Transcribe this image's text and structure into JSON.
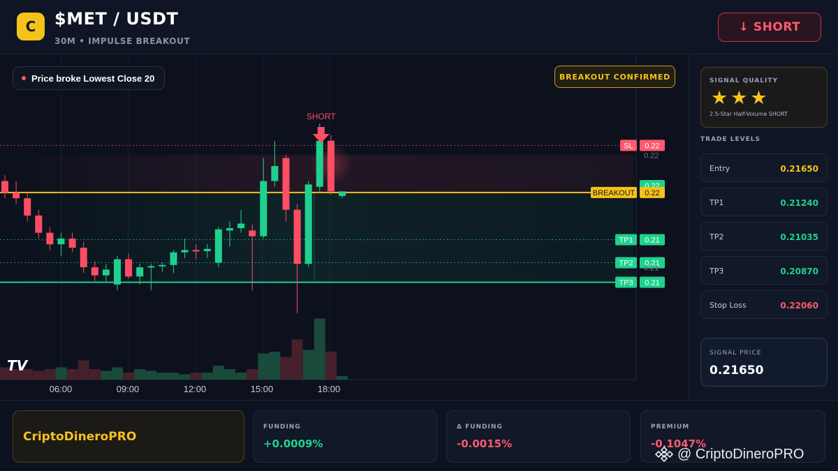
{
  "header": {
    "logo_letter": "C",
    "pair": "$MET / USDT",
    "subtitle": "30M • IMPULSE BREAKOUT",
    "short_button": "↓ SHORT"
  },
  "chart_overlay": {
    "note": "Price broke Lowest Close 20",
    "badge": "BREAKOUT CONFIRMED",
    "signal_label": "SHORT",
    "tv_logo": "TV"
  },
  "chart_data": {
    "type": "candlestick",
    "x_ticks": [
      "06:00",
      "09:00",
      "12:00",
      "15:00",
      "18:00"
    ],
    "candles": [
      {
        "o": 0.2175,
        "h": 0.218,
        "l": 0.216,
        "c": 0.2165
      },
      {
        "o": 0.2165,
        "h": 0.2175,
        "l": 0.2155,
        "c": 0.216
      },
      {
        "o": 0.216,
        "h": 0.2165,
        "l": 0.214,
        "c": 0.2145
      },
      {
        "o": 0.2145,
        "h": 0.215,
        "l": 0.2125,
        "c": 0.213
      },
      {
        "o": 0.213,
        "h": 0.2135,
        "l": 0.2115,
        "c": 0.212
      },
      {
        "o": 0.212,
        "h": 0.213,
        "l": 0.211,
        "c": 0.2125
      },
      {
        "o": 0.2125,
        "h": 0.213,
        "l": 0.2113,
        "c": 0.2117
      },
      {
        "o": 0.2117,
        "h": 0.2122,
        "l": 0.2095,
        "c": 0.21
      },
      {
        "o": 0.21,
        "h": 0.2105,
        "l": 0.2088,
        "c": 0.2093
      },
      {
        "o": 0.2093,
        "h": 0.2103,
        "l": 0.2088,
        "c": 0.2098
      },
      {
        "o": 0.2085,
        "h": 0.211,
        "l": 0.208,
        "c": 0.2107
      },
      {
        "o": 0.2107,
        "h": 0.2112,
        "l": 0.209,
        "c": 0.2092
      },
      {
        "o": 0.2092,
        "h": 0.2103,
        "l": 0.2085,
        "c": 0.21
      },
      {
        "o": 0.21,
        "h": 0.2103,
        "l": 0.208,
        "c": 0.2101
      },
      {
        "o": 0.2101,
        "h": 0.2104,
        "l": 0.2096,
        "c": 0.2102
      },
      {
        "o": 0.2102,
        "h": 0.2115,
        "l": 0.2095,
        "c": 0.2113
      },
      {
        "o": 0.2113,
        "h": 0.2125,
        "l": 0.2108,
        "c": 0.2115
      },
      {
        "o": 0.2115,
        "h": 0.212,
        "l": 0.2107,
        "c": 0.2114
      },
      {
        "o": 0.2114,
        "h": 0.212,
        "l": 0.2108,
        "c": 0.2116
      },
      {
        "o": 0.2104,
        "h": 0.2135,
        "l": 0.21,
        "c": 0.2133
      },
      {
        "o": 0.2132,
        "h": 0.214,
        "l": 0.2118,
        "c": 0.2134
      },
      {
        "o": 0.2134,
        "h": 0.215,
        "l": 0.213,
        "c": 0.2138
      },
      {
        "o": 0.2132,
        "h": 0.2137,
        "l": 0.208,
        "c": 0.2127
      },
      {
        "o": 0.2127,
        "h": 0.2195,
        "l": 0.2125,
        "c": 0.2175
      },
      {
        "o": 0.2175,
        "h": 0.221,
        "l": 0.217,
        "c": 0.2188
      },
      {
        "o": 0.2195,
        "h": 0.2198,
        "l": 0.214,
        "c": 0.215
      },
      {
        "o": 0.215,
        "h": 0.2155,
        "l": 0.206,
        "c": 0.2103
      },
      {
        "o": 0.2103,
        "h": 0.2175,
        "l": 0.21,
        "c": 0.2172
      },
      {
        "o": 0.217,
        "h": 0.2225,
        "l": 0.2165,
        "c": 0.221
      },
      {
        "o": 0.221,
        "h": 0.2215,
        "l": 0.2163,
        "c": 0.2166
      },
      {
        "o": 0.2162,
        "h": 0.2166,
        "l": 0.216,
        "c": 0.2166
      }
    ],
    "volume_relative": [
      0.35,
      0.3,
      0.3,
      0.25,
      0.3,
      0.35,
      0.3,
      0.55,
      0.3,
      0.25,
      0.35,
      0.2,
      0.3,
      0.25,
      0.2,
      0.2,
      0.15,
      0.2,
      0.2,
      0.4,
      0.3,
      0.2,
      0.3,
      0.75,
      0.8,
      0.65,
      1.15,
      0.85,
      1.75,
      0.8,
      0.1
    ],
    "levels": [
      {
        "name": "SL",
        "label": "0.22",
        "price": 0.2206,
        "color": "#ff5a6e"
      },
      {
        "name": "",
        "label": "0.22",
        "price": 0.2171,
        "color": "#1fd18e"
      },
      {
        "name": "BREAKOUT",
        "label": "0.22",
        "price": 0.2165,
        "color": "#f4c21a"
      },
      {
        "name": "TP1",
        "label": "0.21",
        "price": 0.2124,
        "color": "#1fd18e"
      },
      {
        "name": "TP2",
        "label": "0.21",
        "price": 0.2104,
        "color": "#1fd18e"
      },
      {
        "name": "TP3",
        "label": "0.21",
        "price": 0.2087,
        "color": "#1fd18e"
      }
    ],
    "axis_ghost_labels": [
      "0.22",
      "0.21"
    ]
  },
  "panel": {
    "quality_label": "SIGNAL QUALITY",
    "stars": "★★★",
    "quality_desc": "2.5-Star Half-Volume SHORT",
    "levels_title": "TRADE LEVELS",
    "levels": [
      {
        "name": "Entry",
        "value": "0.21650",
        "color": "#f4c21a"
      },
      {
        "name": "TP1",
        "value": "0.21240",
        "color": "#1fd18e"
      },
      {
        "name": "TP2",
        "value": "0.21035",
        "color": "#1fd18e"
      },
      {
        "name": "TP3",
        "value": "0.20870",
        "color": "#1fd18e"
      },
      {
        "name": "Stop Loss",
        "value": "0.22060",
        "color": "#ff5a6e"
      }
    ],
    "signal_price_label": "SIGNAL PRICE",
    "signal_price": "0.21650"
  },
  "footer": {
    "brand": "CriptoDineroPRO",
    "stats": [
      {
        "label": "FUNDING",
        "value": "+0.0009%",
        "color": "#1fd18e"
      },
      {
        "label": "Δ FUNDING",
        "value": "-0.0015%",
        "color": "#ff5a6e"
      },
      {
        "label": "PREMIUM",
        "value": "-0.1047%",
        "color": "#ff5a6e"
      }
    ],
    "watermark": "@ CriptoDineroPRO"
  }
}
